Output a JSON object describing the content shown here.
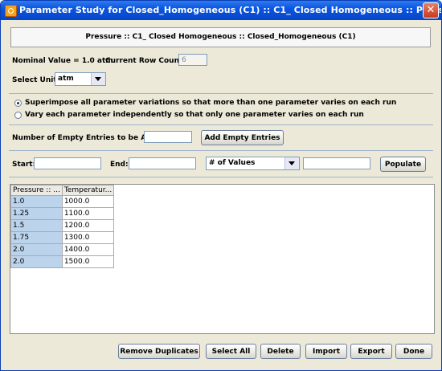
{
  "window": {
    "title": "Parameter Study for Closed_Homogeneous (C1) :: C1_ Closed Homogeneous :: Pressure",
    "close": "✕"
  },
  "header": {
    "text": "Pressure :: C1_ Closed Homogeneous :: Closed_Homogeneous (C1)"
  },
  "info": {
    "nominal_label": "Nominal Value = 1.0 atm",
    "row_count_label": "Current Row Count =",
    "row_count_value": "6",
    "unit_label": "Select Unit:",
    "unit_value": "atm"
  },
  "options": {
    "superimpose": "Superimpose all parameter variations so that more than one parameter varies on each run",
    "independent": "Vary each parameter independently so that only one parameter varies on each run",
    "selected": "superimpose"
  },
  "empty_entries": {
    "label": "Number of Empty Entries to be Added:",
    "value": "",
    "button": "Add Empty Entries"
  },
  "range": {
    "start_label": "Start:",
    "start_value": "",
    "end_label": "End:",
    "end_value": "",
    "mode_value": "# of Values",
    "count_value": "",
    "populate": "Populate"
  },
  "table": {
    "columns": [
      "Pressure :: ...",
      "Temperatur..."
    ],
    "rows": [
      [
        "1.0",
        "1000.0"
      ],
      [
        "1.25",
        "1100.0"
      ],
      [
        "1.5",
        "1200.0"
      ],
      [
        "1.75",
        "1300.0"
      ],
      [
        "2.0",
        "1400.0"
      ],
      [
        "2.0",
        "1500.0"
      ]
    ]
  },
  "buttons": {
    "remove_duplicates": "Remove Duplicates",
    "select_all": "Select All",
    "delete": "Delete",
    "import": "Import",
    "export": "Export",
    "done": "Done"
  }
}
